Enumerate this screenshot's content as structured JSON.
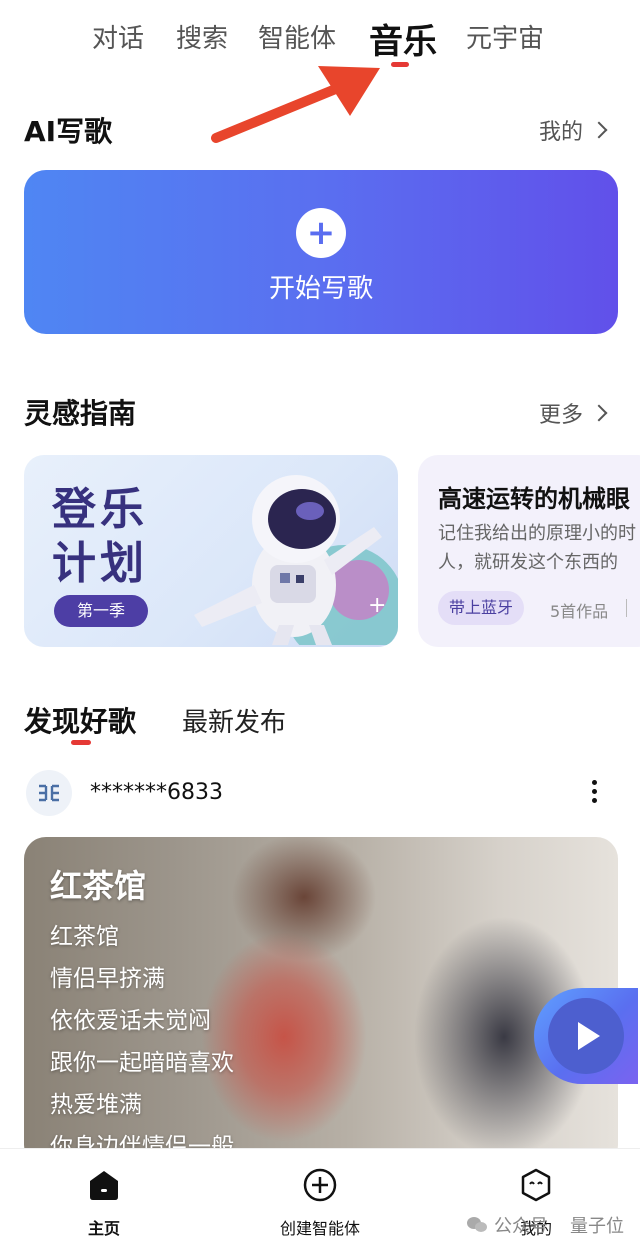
{
  "top_tabs": [
    {
      "label": "对话"
    },
    {
      "label": "搜索"
    },
    {
      "label": "智能体"
    },
    {
      "label": "音乐"
    },
    {
      "label": "元宇宙"
    }
  ],
  "active_tab": "音乐",
  "ai_write": {
    "title": "AI写歌",
    "more": "我的",
    "start_label": "开始写歌"
  },
  "inspiration": {
    "title": "灵感指南",
    "more": "更多",
    "card1": {
      "title_line1": "登乐",
      "title_line2": "计划",
      "season": "第一季"
    },
    "card2": {
      "title": "高速运转的机械眼",
      "desc_line1": "记住我给出的原理小的时",
      "desc_line2": "人，就研发这个东西的",
      "tag": "带上蓝牙",
      "count": "5首作品"
    }
  },
  "discover": {
    "tab_discover": "发现好歌",
    "tab_latest": "最新发布"
  },
  "post": {
    "user": "*******6833",
    "song_title": "红茶馆",
    "lyrics": [
      "红茶馆",
      "情侣早挤满",
      "依依爱话未觉闷",
      "跟你一起暗暗喜欢",
      "热爱堆满",
      "你身边伴情侣一般"
    ]
  },
  "bottom_nav": [
    {
      "label": "主页",
      "icon": "home-icon"
    },
    {
      "label": "创建智能体",
      "icon": "plus-circle-icon"
    },
    {
      "label": "我的",
      "icon": "profile-icon"
    }
  ],
  "watermark": {
    "text_left": "公众号",
    "text_right": "量子位"
  },
  "colors": {
    "accent": "#e53935",
    "brand_blue": "#5a6ff0",
    "brand_purple": "#4d3ea5"
  }
}
